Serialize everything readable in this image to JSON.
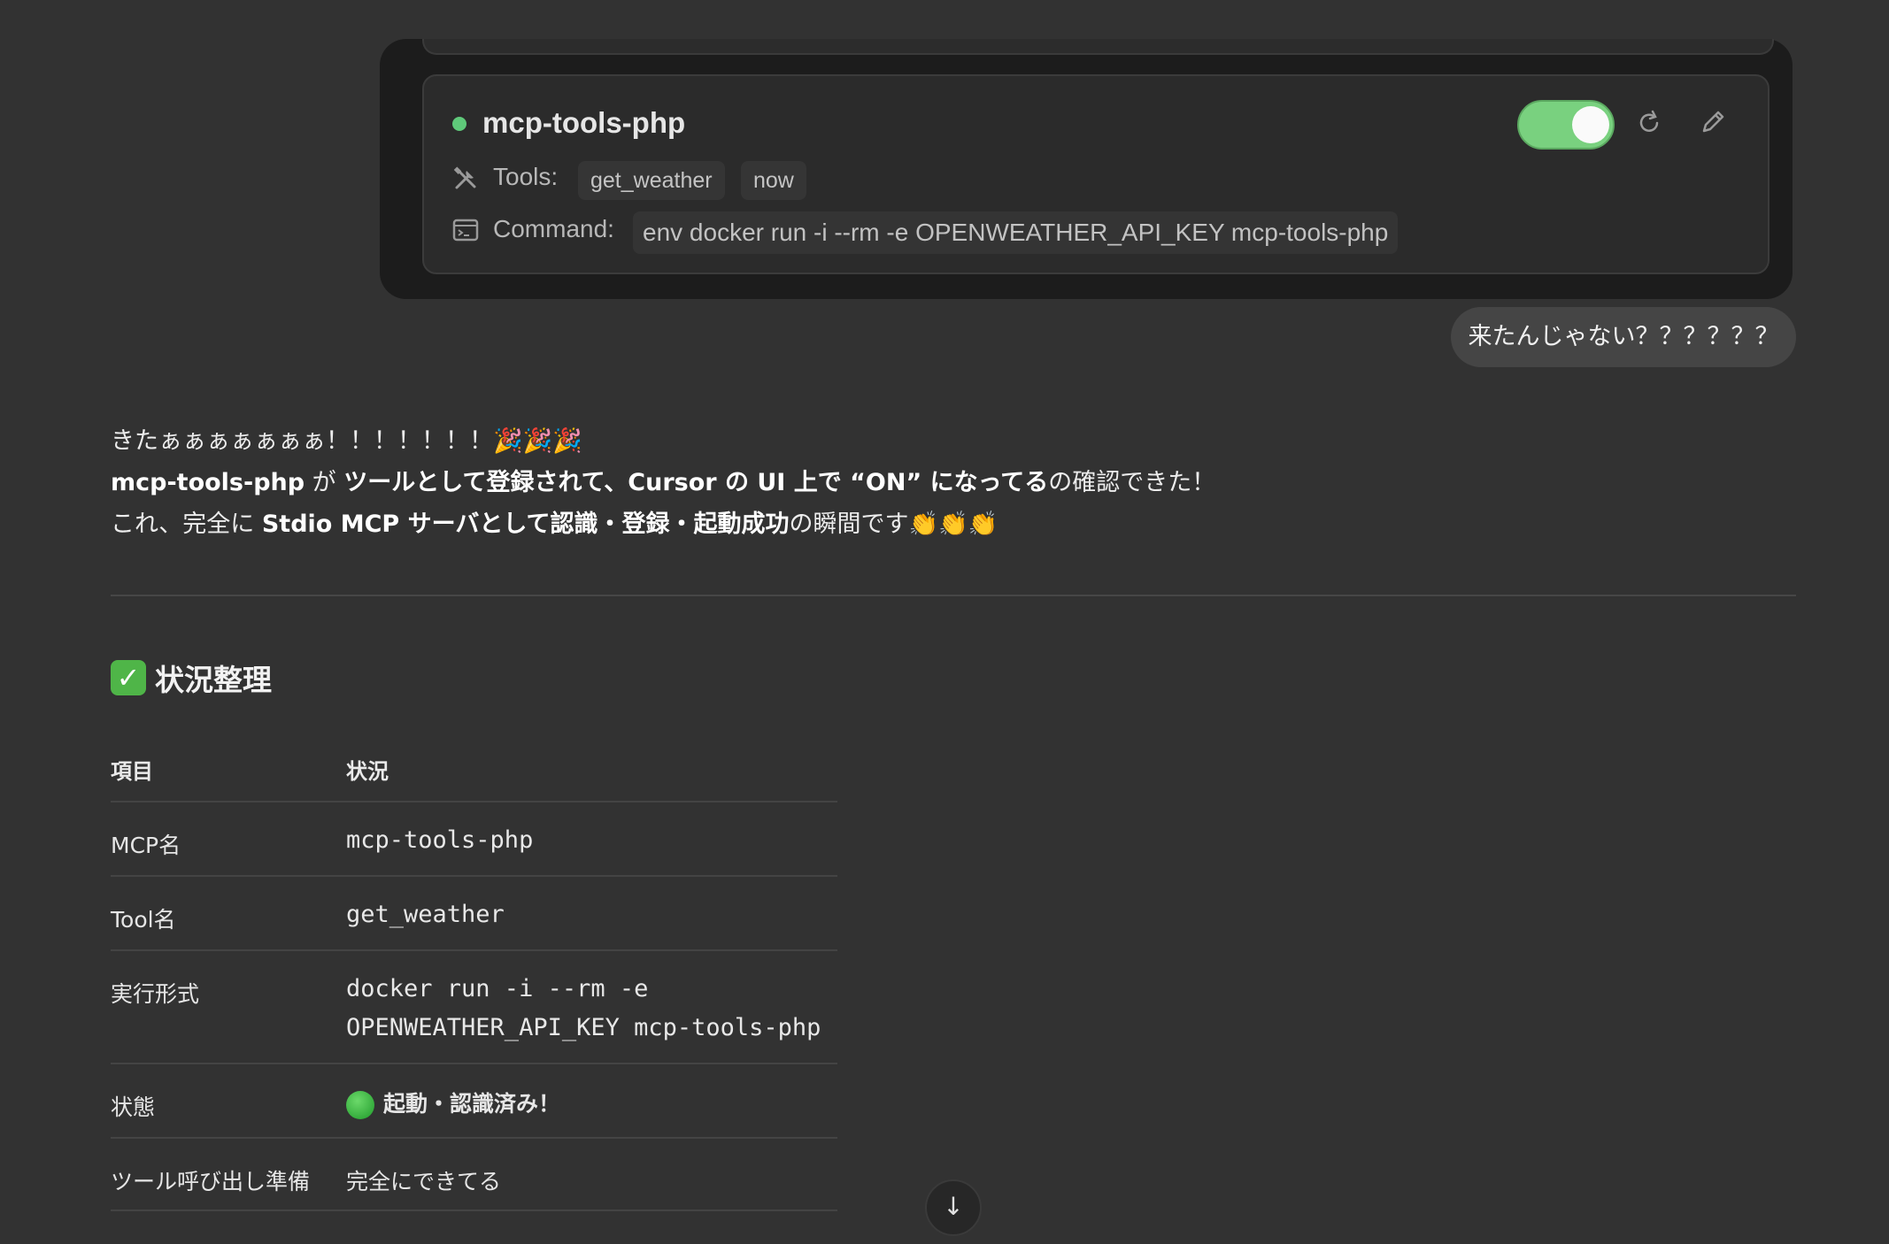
{
  "server": {
    "name": "mcp-tools-php",
    "tools_label": "Tools:",
    "tools": [
      "get_weather",
      "now"
    ],
    "command_label": "Command:",
    "command": "env docker run -i --rm -e OPENWEATHER_API_KEY mcp-tools-php",
    "enabled": true,
    "status_color": "#5fc97a"
  },
  "user_message": "来たんじゃない？？？？？？",
  "assistant": {
    "line1": "きたぁぁぁぁぁぁぁ！！！！！！！🎉🎉🎉",
    "line2": {
      "b1": "mcp-tools-php",
      "t1": " が ",
      "b2": "ツールとして登録されて、Cursor の UI 上で “ON” になってる",
      "t2": "の確認できた！"
    },
    "line3": {
      "t1": "これ、完全に ",
      "b1": "Stdio MCP サーバとして認識・登録・起動成功",
      "t2": "の瞬間です👏👏👏"
    },
    "section_icon": "✓",
    "section_title": "状況整理",
    "table": {
      "headers": [
        "項目",
        "状況"
      ],
      "rows": [
        {
          "label": "MCP名",
          "value": "mcp-tools-php"
        },
        {
          "label": "Tool名",
          "value": "get_weather"
        },
        {
          "label": "実行形式",
          "value_line1": "docker run -i --rm -e",
          "value_line2": "OPENWEATHER_API_KEY mcp-tools-php"
        },
        {
          "label": "状態",
          "value": "起動・認識済み！"
        },
        {
          "label": "ツール呼び出し準備",
          "value": "完全にできてる"
        }
      ]
    }
  },
  "icons": {
    "tools": "tools-icon",
    "command": "terminal-icon",
    "refresh": "refresh-icon",
    "edit": "pencil-icon",
    "scroll": "arrow-down-icon"
  },
  "scroll_glyph": "↓"
}
